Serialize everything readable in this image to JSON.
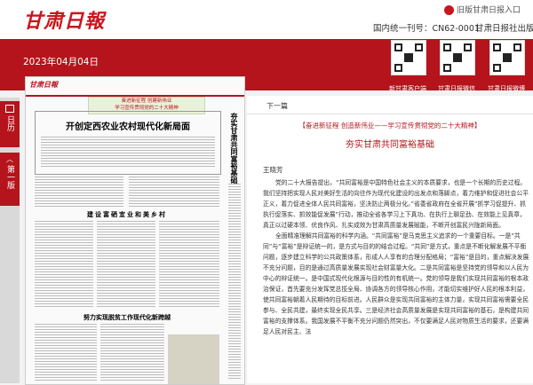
{
  "header": {
    "logo_text": "甘肃日報",
    "sso_label": "旧版甘肃日报入口",
    "cn_number": "国内统一刊号：CN62-0001",
    "org_label": "甘肃日报社出版",
    "date": "2023年04月04日"
  },
  "qr_codes": [
    {
      "label": "新甘肃客户端"
    },
    {
      "label": "甘肃日报微信"
    },
    {
      "label": "甘肃日报微博"
    }
  ],
  "sidebar": {
    "tab_top": "日历",
    "tab_bottom": "第一版"
  },
  "paper": {
    "masthead": "甘肃日報",
    "banner_line1": "奋进新征程 创建新伟业",
    "banner_line2": "学习宣传贯彻党的二十大精神",
    "headline": "开创定西农业农村现代化新局面",
    "vertical_title": "夯实甘肃共同富裕基础",
    "subhead1": "建设富硒宜业和美乡村",
    "subhead2": "努力实现脱贫工作现代化新跨越"
  },
  "article": {
    "next_page": "下一篇",
    "kicker": "【奋进新征程 创造新伟业——学习宣传贯彻党的二十大精神】",
    "title": "夯实甘肃共同富裕基础",
    "author": "王晓芳",
    "paragraphs": [
      "党的二十大报告提出，“共同富裕是中国特色社会主义的本质要求，也是一个长期的历史过程。我们坚持把实现人民对美好生活的向往作为现代化建设的出发点和落脚点，着力维护和促进社会公平正义，着力促进全体人民共同富裕，坚决防止两极分化。”省委省政府在全省开展“抓学习促提升、抓执行促落实、抓效能促发展”行动，推动全省各学习上下真功、在执行上聊足劲、在效能上见真章，真正以过硬本领、优良作风、扎实成效为甘肃高质量发展赋能，不断开创富民兴陇新局面。",
      "全面精准理解共同富裕的科学内涵。“共同富裕”是马克思主义追求的一个重要目标。一是“共同”与“富裕”是辩证统一的，是方式与目的的结合过程。“共同”是方式，重点是不断化解发展不平衡问题，逐步建立科学的公共政策体系，形成人人享有的合理分配格局；“富裕”是目的，重点解决发展不充分问题，目的是通过高质量发展实现社会财富量大化。二是共同富裕是坚持党的领导和以人民为中心的辩证统一。是中国式现代化根源与目的性的有机统一。党的领导是我们实现共同富裕的根本政治保证，首先要充分发挥党总揽全局、协调各方的领导核心作用，才能切实维护好人民的根本利益，使共同富裕朝着人民期待的目标前进。人民群众是实现共同富裕的主体力量，实现共同富裕需要全民参与、全民共建，最终实现全民共享。三是经济社会高质量发展是实现共同富裕的基石，是构建共同富裕的支撑体系。我国发展不平衡不充分问题仍然突出，不仅要满足人民对物质生活的要求，还要满足人民对民主、法"
    ]
  }
}
